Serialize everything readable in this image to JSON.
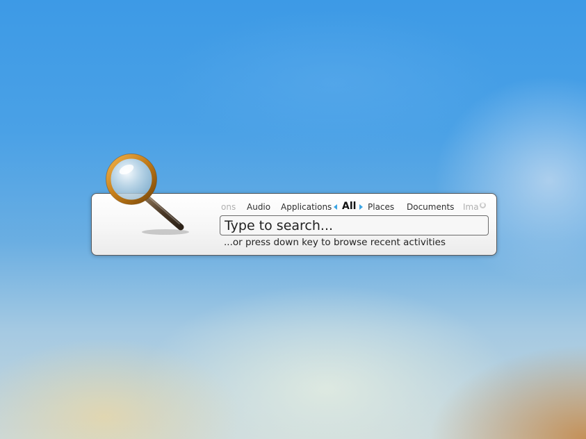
{
  "runner": {
    "tabs": [
      {
        "label": "ons",
        "state": "faded"
      },
      {
        "label": "Audio",
        "state": "normal"
      },
      {
        "label": "Applications",
        "state": "normal"
      },
      {
        "label": "All",
        "state": "active"
      },
      {
        "label": "Places",
        "state": "normal"
      },
      {
        "label": "Documents",
        "state": "normal"
      },
      {
        "label": "Ima",
        "state": "faded"
      }
    ],
    "search": {
      "placeholder": "Type to search...",
      "value": ""
    },
    "hint": "...or press down key to browse recent activities"
  },
  "icons": {
    "magnifier": "magnifier-icon",
    "prev_tab": "left-arrow-icon",
    "next_tab": "right-arrow-icon",
    "busy": "spinner-icon"
  },
  "colors": {
    "accent": "#3aa4e4",
    "magnifier_rim": "#c07a18",
    "magnifier_handle": "#5a4630"
  }
}
